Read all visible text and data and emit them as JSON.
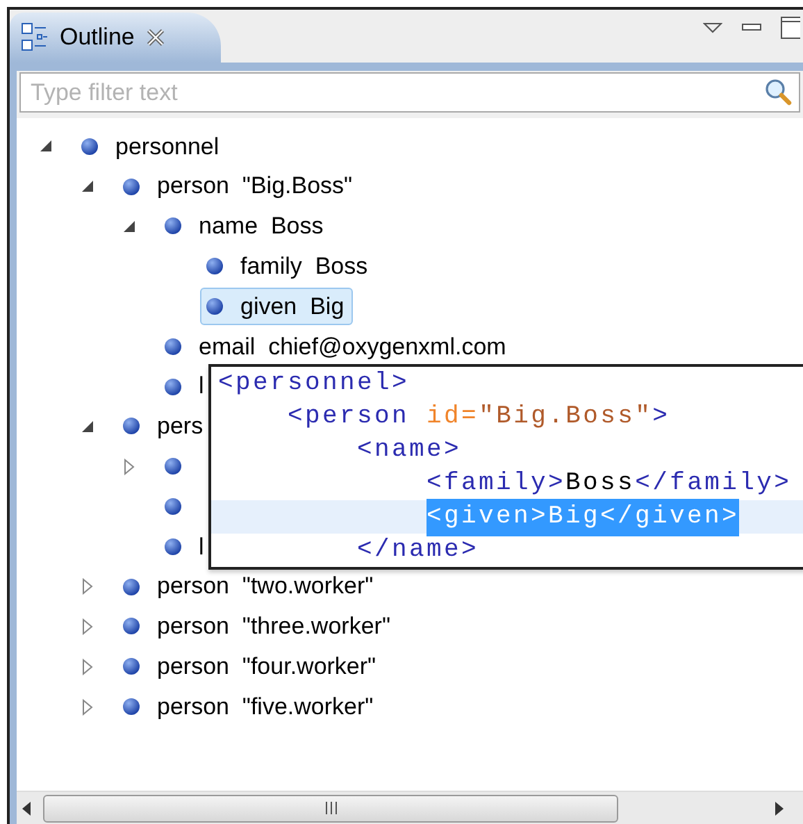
{
  "tab": {
    "title": "Outline",
    "selected": true
  },
  "filter": {
    "placeholder": "Type filter text"
  },
  "tree": [
    {
      "label": "personnel",
      "expanded": true,
      "selected": false,
      "children": [
        {
          "label": "person  \"Big.Boss\"",
          "expanded": true,
          "selected": false,
          "children": [
            {
              "label": "name  Boss",
              "expanded": true,
              "selected": false,
              "children": [
                {
                  "label": "family  Boss",
                  "selected": false
                },
                {
                  "label": "given  Big",
                  "selected": true
                }
              ]
            },
            {
              "label": "email  chief@oxygenxml.com",
              "selected": false
            },
            {
              "label": "l",
              "selected": false
            }
          ]
        },
        {
          "label": "pers",
          "expanded": true,
          "selected": false,
          "children": [
            {
              "expanded": false,
              "selected": false
            },
            {
              "selected": false
            },
            {
              "label": "l",
              "selected": false
            }
          ]
        },
        {
          "label": "person  \"two.worker\"",
          "expanded": false,
          "selected": false
        },
        {
          "label": "person  \"three.worker\"",
          "expanded": false,
          "selected": false
        },
        {
          "label": "person  \"four.worker\"",
          "expanded": false,
          "selected": false
        },
        {
          "label": "person  \"five.worker\"",
          "expanded": false,
          "selected": false
        }
      ]
    }
  ],
  "tooltip": {
    "lines": [
      {
        "selected": false,
        "segments": [
          {
            "kind": "tag",
            "text": "<personnel>"
          }
        ]
      },
      {
        "selected": false,
        "segments": [
          {
            "kind": "tag",
            "text": "    <person"
          },
          {
            "kind": "attr",
            "text": " id="
          },
          {
            "kind": "value",
            "text": "\"Big.Boss\""
          },
          {
            "kind": "tag",
            "text": ">"
          }
        ]
      },
      {
        "selected": false,
        "segments": [
          {
            "kind": "tag",
            "text": "        <name>"
          }
        ]
      },
      {
        "selected": false,
        "segments": [
          {
            "kind": "tag",
            "text": "            <family>"
          },
          {
            "kind": "text",
            "text": "Boss"
          },
          {
            "kind": "tag",
            "text": "</family>"
          }
        ]
      },
      {
        "selected": true,
        "segments": [
          {
            "kind": "tag",
            "text": "            <given>Big</given>"
          }
        ]
      },
      {
        "selected": false,
        "segments": [
          {
            "kind": "tag",
            "text": "        </name>"
          }
        ]
      }
    ]
  }
}
